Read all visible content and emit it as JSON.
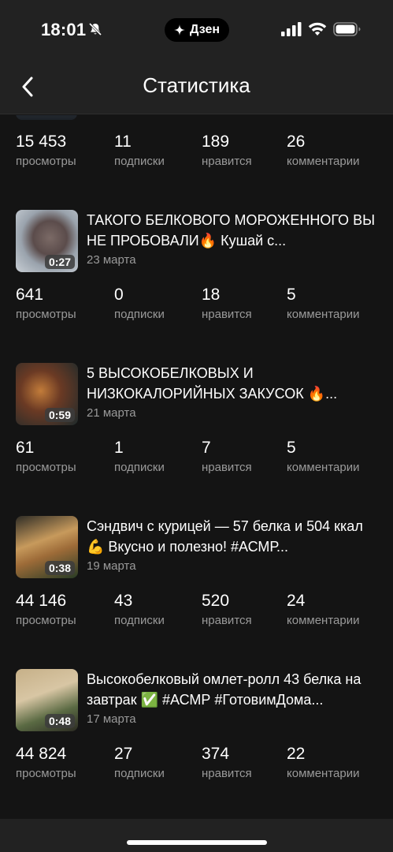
{
  "status_bar": {
    "time": "18:01",
    "pill_label": "Дзен"
  },
  "header": {
    "title": "Статистика"
  },
  "top_stats": {
    "views": "15 453",
    "subs": "11",
    "likes": "189",
    "comments": "26"
  },
  "labels": {
    "views": "просмотры",
    "subs": "подписки",
    "likes": "нравится",
    "comments": "комментарии"
  },
  "videos": [
    {
      "title": "ТАКОГО БЕЛКОВОГО МОРОЖЕННОГО ВЫ НЕ ПРОБОВАЛИ🔥 Кушай с...",
      "date": "23 марта",
      "duration": "0:27",
      "views": "641",
      "subs": "0",
      "likes": "18",
      "comments": "5"
    },
    {
      "title": "5 ВЫСОКОБЕЛКОВЫХ И НИЗКОКАЛОРИЙНЫХ ЗАКУСОК 🔥...",
      "date": "21 марта",
      "duration": "0:59",
      "views": "61",
      "subs": "1",
      "likes": "7",
      "comments": "5"
    },
    {
      "title": "Сэндвич с курицей — 57 белка и 504 ккал 💪 Вкусно и полезно! #АСМР...",
      "date": "19 марта",
      "duration": "0:38",
      "views": "44 146",
      "subs": "43",
      "likes": "520",
      "comments": "24"
    },
    {
      "title": "Высокобелковый омлет-ролл 43 белка на завтрак ✅ #АСМР #ГотовимДома...",
      "date": "17 марта",
      "duration": "0:48",
      "views": "44 824",
      "subs": "27",
      "likes": "374",
      "comments": "22"
    }
  ]
}
